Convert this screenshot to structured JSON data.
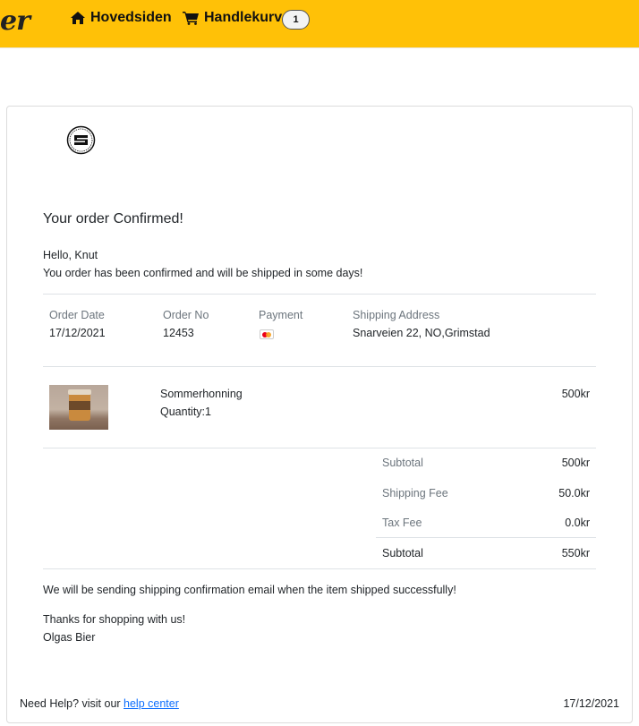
{
  "navbar": {
    "brand": "er",
    "home_label": "Hovedsiden",
    "cart_label": "Handlekurv",
    "cart_count": "1",
    "accent_color": "#ffc107"
  },
  "order": {
    "title": "Your order Confirmed!",
    "greeting": "Hello, Knut",
    "message": "You order has been confirmed and will be shipped in some days!",
    "info": {
      "order_date_label": "Order Date",
      "order_date": "17/12/2021",
      "order_no_label": "Order No",
      "order_no": "12453",
      "payment_label": "Payment",
      "payment_icon": "mastercard-icon",
      "shipping_address_label": "Shipping Address",
      "shipping_address": "Snarveien 22, NO,Grimstad"
    },
    "items": [
      {
        "name": "Sommerhonning",
        "quantity": "Quantity:1",
        "price": "500kr"
      }
    ],
    "summary": {
      "subtotal_label": "Subtotal",
      "subtotal": "500kr",
      "shipping_fee_label": "Shipping Fee",
      "shipping_fee": "50.0kr",
      "tax_fee_label": "Tax Fee",
      "tax_fee": "0.0kr",
      "total_label": "Subtotal",
      "total": "550kr"
    },
    "shipping_note": "We will be sending shipping confirmation email when the item shipped successfully!",
    "thanks": "Thanks for shopping with us!",
    "signature": "Olgas Bier"
  },
  "footer": {
    "help_text": "Need Help? visit our ",
    "help_link": "help center",
    "date": "17/12/2021"
  }
}
